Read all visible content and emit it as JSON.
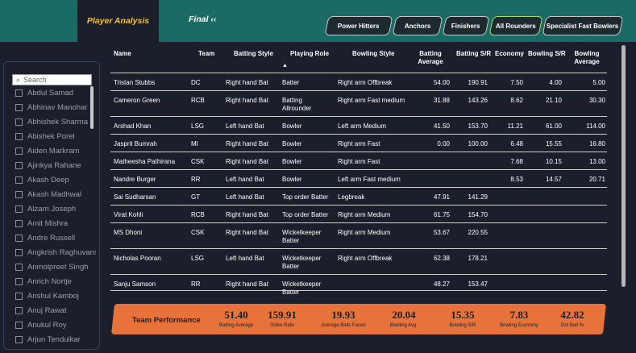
{
  "nav": {
    "active_tab": "Player Analysis",
    "second_tab": "Final ‹‹",
    "filters": [
      {
        "label": "Power Hitters"
      },
      {
        "label": "Anchors"
      },
      {
        "label": "Finishers"
      },
      {
        "label": "All Rounders"
      },
      {
        "label": "Specialist Fast Bowlers"
      }
    ]
  },
  "sidebar": {
    "search_placeholder": "Search",
    "players": [
      "Abdul Samad",
      "Abhinav Manohar",
      "Abhishek Sharma",
      "Abishek Porel",
      "Aiden Markram",
      "Ajinkya Rahane",
      "Akash Deep",
      "Akash Madhwal",
      "Alzarri Joseph",
      "Amit Mishra",
      "Andre Russell",
      "Angkrish Raghuvanshi",
      "Anmolpreet Singh",
      "Anrich Nortje",
      "Anshul Kamboj",
      "Anuj Rawat",
      "Anukul Roy",
      "Arjun Tendulkar"
    ]
  },
  "table": {
    "headers": {
      "name": "Name",
      "team": "Team",
      "batting_style": "Batting Style",
      "playing_role": "Playing Role",
      "bowling_style": "Bowling Style",
      "batting_average": "Batting Average",
      "batting_sr": "Batting S/R",
      "economy": "Economy",
      "bowling_sr": "Bowling S/R",
      "bowling_average": "Bowling Average"
    },
    "sort_indicator": "▲",
    "rows": [
      {
        "name": "Tristan Stubbs",
        "team": "DC",
        "bat": "Right hand Bat",
        "role": "Batter",
        "bowl": "Right arm Offbreak",
        "bavg": "54.00",
        "bsr": "190.91",
        "eco": "7.50",
        "bwsr": "4.00",
        "bwavg": "5.00"
      },
      {
        "name": "Cameron Green",
        "team": "RCB",
        "bat": "Right hand Bat",
        "role": "Batting Allrounder",
        "bowl": "Right arm Fast medium",
        "bavg": "31.88",
        "bsr": "143.26",
        "eco": "8.62",
        "bwsr": "21.10",
        "bwavg": "30.30"
      },
      {
        "name": "Arshad Khan",
        "team": "LSG",
        "bat": "Left hand Bat",
        "role": "Bowler",
        "bowl": "Left arm Medium",
        "bavg": "41.50",
        "bsr": "153.70",
        "eco": "11.21",
        "bwsr": "61.00",
        "bwavg": "114.00"
      },
      {
        "name": "Jasprit Bumrah",
        "team": "MI",
        "bat": "Right hand Bat",
        "role": "Bowler",
        "bowl": "Right arm Fast",
        "bavg": "0.00",
        "bsr": "100.00",
        "eco": "6.48",
        "bwsr": "15.55",
        "bwavg": "16.80"
      },
      {
        "name": "Matheesha Pathirana",
        "team": "CSK",
        "bat": "Right hand Bat",
        "role": "Bowler",
        "bowl": "Right arm Fast",
        "bavg": "",
        "bsr": "",
        "eco": "7.68",
        "bwsr": "10.15",
        "bwavg": "13.00"
      },
      {
        "name": "Nandre Burger",
        "team": "RR",
        "bat": "Left hand Bat",
        "role": "Bowler",
        "bowl": "Left arm Fast medium",
        "bavg": "",
        "bsr": "",
        "eco": "8.53",
        "bwsr": "14.57",
        "bwavg": "20.71"
      },
      {
        "name": "Sai Sudharsan",
        "team": "GT",
        "bat": "Left hand Bat",
        "role": "Top order Batter",
        "bowl": "Legbreak",
        "bavg": "47.91",
        "bsr": "141.29",
        "eco": "",
        "bwsr": "",
        "bwavg": ""
      },
      {
        "name": "Virat Kohli",
        "team": "RCB",
        "bat": "Right hand Bat",
        "role": "Top order Batter",
        "bowl": "Right arm Medium",
        "bavg": "61.75",
        "bsr": "154.70",
        "eco": "",
        "bwsr": "",
        "bwavg": ""
      },
      {
        "name": "MS Dhoni",
        "team": "CSK",
        "bat": "Right hand Bat",
        "role": "Wicketkeeper Batter",
        "bowl": "Right arm Medium",
        "bavg": "53.67",
        "bsr": "220.55",
        "eco": "",
        "bwsr": "",
        "bwavg": ""
      },
      {
        "name": "Nicholas Pooran",
        "team": "LSG",
        "bat": "Left hand Bat",
        "role": "Wicketkeeper Batter",
        "bowl": "Right arm Offbreak",
        "bavg": "62.38",
        "bsr": "178.21",
        "eco": "",
        "bwsr": "",
        "bwavg": ""
      },
      {
        "name": "Sanju Samson",
        "team": "RR",
        "bat": "Right hand Bat",
        "role": "Wicketkeeper Batter",
        "bowl": "",
        "bavg": "48.27",
        "bsr": "153.47",
        "eco": "",
        "bwsr": "",
        "bwavg": ""
      }
    ]
  },
  "performance": {
    "title": "Team Performance",
    "kpis": [
      {
        "value": "51.40",
        "label": "Batting Average"
      },
      {
        "value": "159.91",
        "label": "Strike Rate"
      },
      {
        "value": "19.93",
        "label": "Average Balls Faced"
      },
      {
        "value": "20.04",
        "label": "Bowling Avg."
      },
      {
        "value": "15.35",
        "label": "Bowling S/R"
      },
      {
        "value": "7.83",
        "label": "Bowling Economy"
      },
      {
        "value": "42.82",
        "label": "Dot Ball %"
      }
    ]
  },
  "colors": {
    "header_bg": "#1a6b66",
    "page_bg": "#1b1f2b",
    "accent_yellow": "#f1c232",
    "kpi_band": "#e8733a",
    "active_filter_border": "#a8e063"
  }
}
